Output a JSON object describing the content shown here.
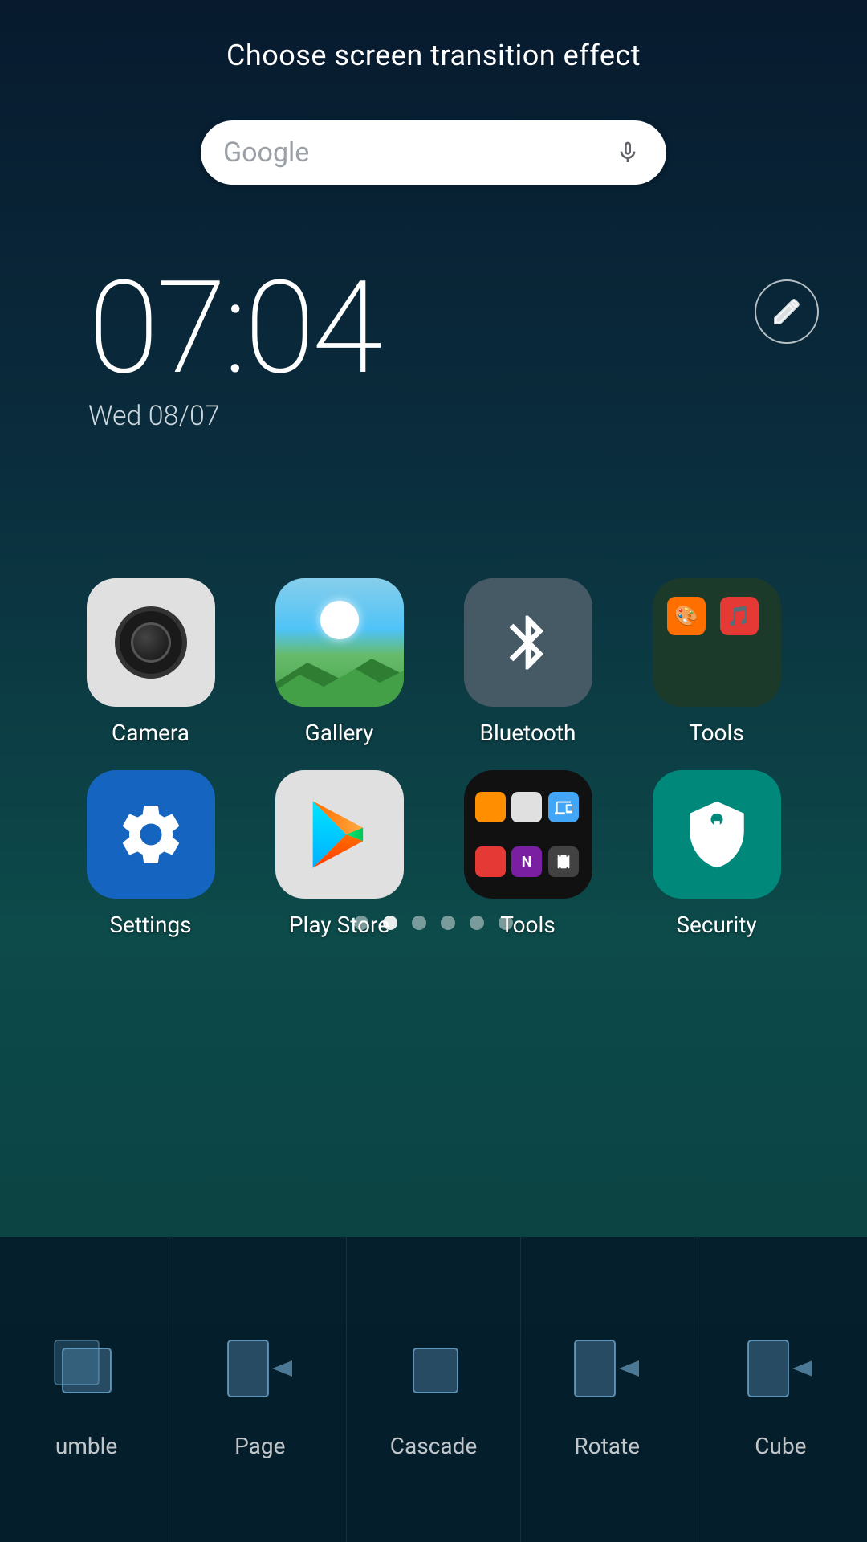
{
  "header": {
    "title": "Choose screen transition effect"
  },
  "search": {
    "placeholder": "Google",
    "mic_label": "microphone"
  },
  "clock": {
    "time": "07:04",
    "date": "Wed 08/07"
  },
  "apps": {
    "row1": [
      {
        "id": "camera",
        "label": "Camera"
      },
      {
        "id": "gallery",
        "label": "Gallery"
      },
      {
        "id": "bluetooth",
        "label": "Bluetooth"
      },
      {
        "id": "tools-folder",
        "label": "Tools"
      }
    ],
    "row2": [
      {
        "id": "settings",
        "label": "Settings"
      },
      {
        "id": "playstore",
        "label": "Play Store"
      },
      {
        "id": "tools-grid",
        "label": "Tools"
      },
      {
        "id": "security",
        "label": "Security"
      }
    ]
  },
  "dots": {
    "total": 6,
    "active": 1
  },
  "transitions": [
    {
      "id": "tumble",
      "label": "umble",
      "shape": "tumble"
    },
    {
      "id": "page",
      "label": "Page",
      "shape": "page"
    },
    {
      "id": "cascade",
      "label": "Cascade",
      "shape": "cascade"
    },
    {
      "id": "rotate",
      "label": "Rotate",
      "shape": "rotate"
    },
    {
      "id": "cube",
      "label": "Cube",
      "shape": "cube"
    }
  ]
}
